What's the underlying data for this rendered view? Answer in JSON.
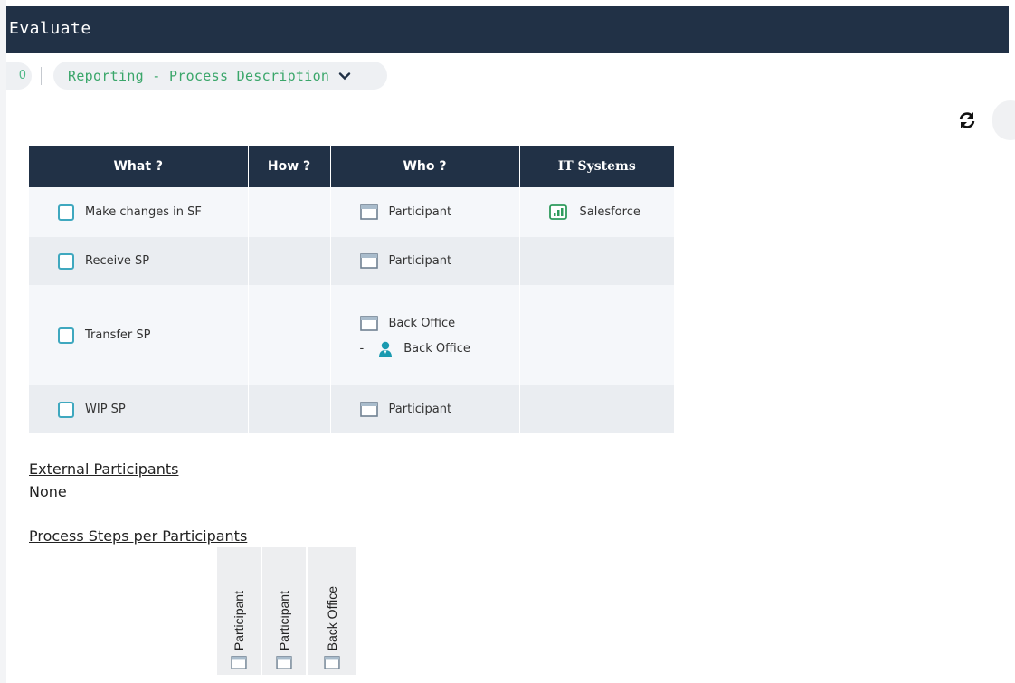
{
  "header": {
    "title": "Evaluate"
  },
  "breadcrumb": {
    "prev_glyph": "0",
    "current": "Reporting - Process Description"
  },
  "table": {
    "headers": [
      "What ?",
      "How ?",
      "Who ?",
      "IT Systems"
    ],
    "rows": [
      {
        "what": "Make changes in SF",
        "how": "",
        "who": [
          "Participant"
        ],
        "who_person": "",
        "it": "Salesforce"
      },
      {
        "what": "Receive SP",
        "how": "",
        "who": [
          "Participant"
        ],
        "who_person": "",
        "it": ""
      },
      {
        "what": "Transfer SP",
        "how": "",
        "who": [
          "Back Office"
        ],
        "who_dash": "-",
        "who_person": "Back Office",
        "it": ""
      },
      {
        "what": "WIP SP",
        "how": "",
        "who": [
          "Participant"
        ],
        "who_person": "",
        "it": ""
      }
    ]
  },
  "external": {
    "title": "External Participants",
    "value": "None"
  },
  "steps": {
    "title": "Process Steps per Participants",
    "columns": [
      "Participant",
      "Participant",
      "Back Office"
    ]
  },
  "icons": {
    "role": "role-window-icon",
    "person": "person-icon",
    "system": "system-chart-icon",
    "refresh": "refresh-icon",
    "chevron": "chevron-down-icon"
  },
  "colors": {
    "header_bg": "#213146",
    "accent_green": "#3aa66a",
    "checkbox": "#3fa8bf",
    "person": "#1a9ab0"
  }
}
